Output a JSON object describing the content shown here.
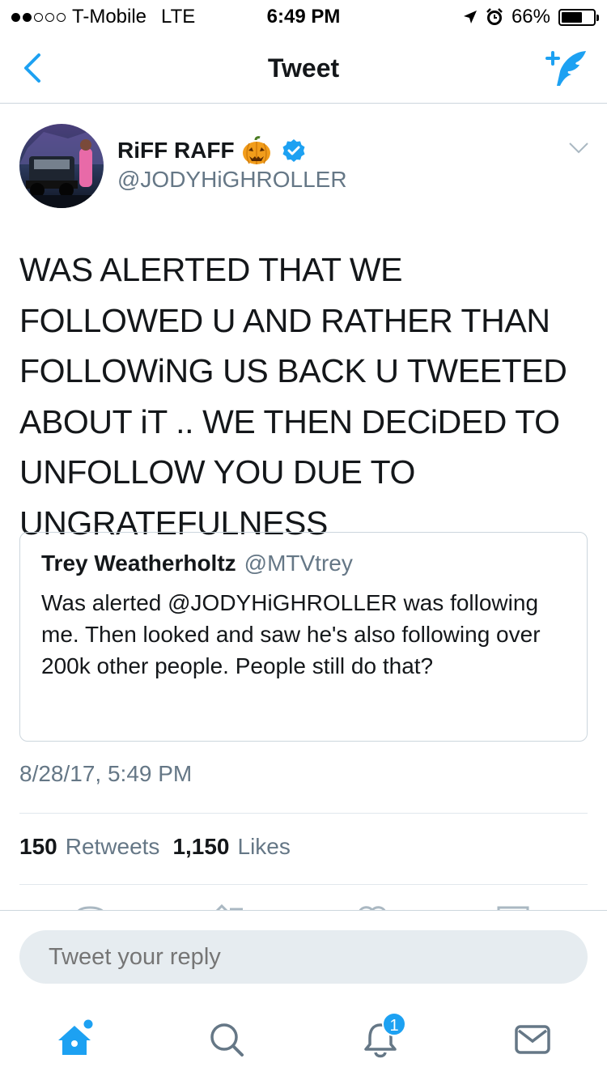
{
  "status_bar": {
    "carrier": "T-Mobile",
    "network": "LTE",
    "time": "6:49 PM",
    "battery_percent": "66%",
    "battery_level": 0.66,
    "signal_bars": 2,
    "icons": [
      "location-arrow-icon",
      "alarm-icon",
      "battery-icon"
    ]
  },
  "nav": {
    "title": "Tweet",
    "back_icon": "chevron-left-icon",
    "compose_icon": "compose-tweet-icon"
  },
  "tweet": {
    "author_name": "RiFF RAFF",
    "author_emoji": "🎃",
    "verified": true,
    "handle": "@JODYHiGHROLLER",
    "text": "WAS ALERTED THAT WE FOLLOWED U AND RATHER THAN FOLLOWiNG US BACK U TWEETED ABOUT iT .. WE THEN DECiDED TO UNFOLLOW YOU DUE TO UNGRATEFULNESS",
    "timestamp": "8/28/17, 5:49 PM",
    "retweets_count": "150",
    "retweets_label": "Retweets",
    "likes_count": "1,150",
    "likes_label": "Likes"
  },
  "quoted": {
    "name": "Trey Weatherholtz",
    "handle": "@MTVtrey",
    "text": "Was alerted @JODYHiGHROLLER was following me. Then looked and saw he's also following over 200k other people. People still do that?"
  },
  "reply": {
    "placeholder": "Tweet your reply"
  },
  "tab_bar": {
    "tabs": [
      "home-icon",
      "search-icon",
      "notifications-icon",
      "messages-icon"
    ],
    "notification_badge": "1"
  },
  "colors": {
    "accent": "#1da1f2",
    "text": "#14171a",
    "secondary": "#657786",
    "border": "#ccd6dd",
    "input_bg": "#e6ecf0"
  }
}
